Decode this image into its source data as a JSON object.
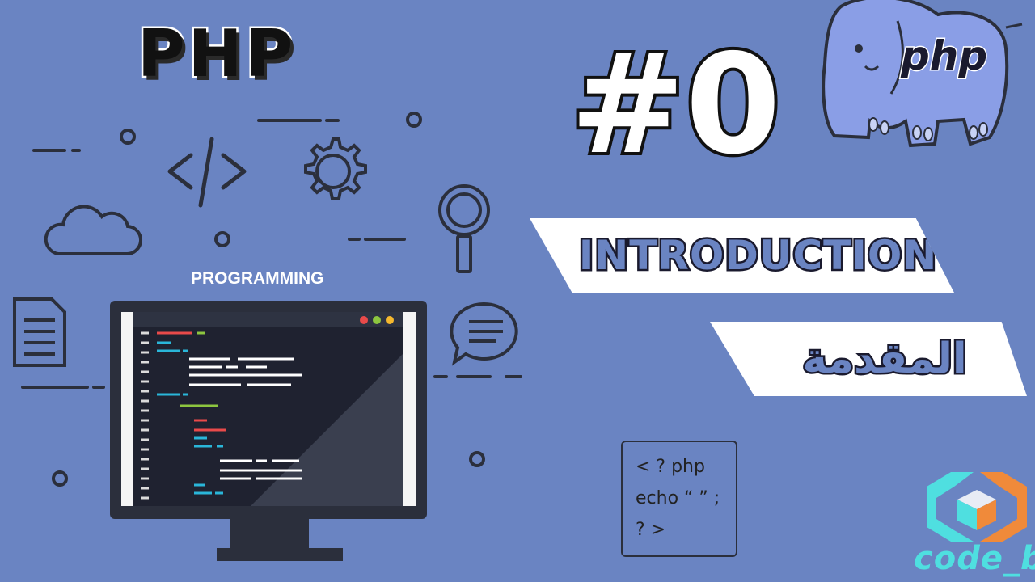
{
  "thumbnail": {
    "title": "PHP",
    "episode": "#0",
    "subtitle_en": "INTRODUCTION",
    "subtitle_ar": "المقدمة",
    "illustration_label": "PROGRAMMING",
    "logo_text": "php",
    "code_snippet": [
      "< ? php",
      "echo “ ” ;",
      "? >"
    ],
    "brand": "code_bh"
  },
  "colors": {
    "background": "#6a84c2",
    "monitor_frame": "#2b2f3c",
    "screen": "#1f2230",
    "elephant": "#8a9ee6",
    "brand_cyan": "#4fdfe0",
    "brand_orange": "#f08a3a"
  },
  "icons": [
    "code-icon",
    "gear-icon",
    "cloud-icon",
    "search-icon",
    "document-icon",
    "chat-icon",
    "php-elephant-logo",
    "code-bh-logo",
    "monitor-illustration"
  ]
}
